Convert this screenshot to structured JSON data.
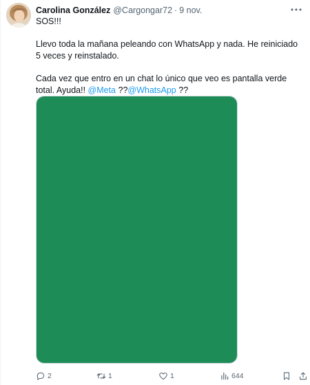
{
  "author": {
    "display_name": "Carolina González",
    "handle": "@Cargongar72",
    "separator": "·",
    "time": "9 nov."
  },
  "tweet": {
    "line1": "SOS!!!",
    "line2": "Llevo toda la mañana peleando con WhatsApp y nada. He reiniciado 5 veces y reinstalado.",
    "line3_prefix": "Cada vez que entro en un chat lo único que veo es pantalla verde total. Ayuda!! ",
    "mention1": "@Meta",
    "between": " ??",
    "mention2": "@WhatsApp",
    "suffix": " ??"
  },
  "media": {
    "fill_color": "#1e8c57"
  },
  "actions": {
    "reply_count": "2",
    "retweet_count": "1",
    "like_count": "1",
    "views_count": "644"
  },
  "icons": {
    "more": "more-icon",
    "reply": "reply-icon",
    "retweet": "retweet-icon",
    "like": "heart-icon",
    "views": "views-icon",
    "bookmark": "bookmark-icon",
    "share": "share-icon"
  },
  "colors": {
    "text": "#0f1419",
    "secondary": "#536471",
    "link": "#1d9bf0",
    "border": "#cfd9de"
  }
}
